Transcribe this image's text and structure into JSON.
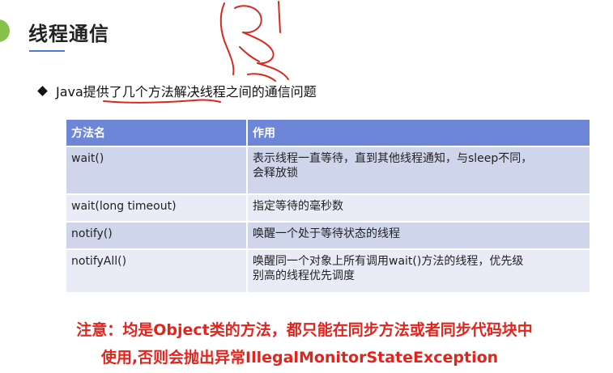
{
  "slide": {
    "title": "线程通信",
    "intro": "Java提供了几个方法解决线程之间的通信问题",
    "table": {
      "headers": [
        "方法名",
        "作用"
      ],
      "rows": [
        {
          "method": "wait()",
          "desc_line1": "表示线程一直等待，直到其他线程通知，与sleep不同，",
          "desc_line2": "会释放锁"
        },
        {
          "method": "wait(long timeout)",
          "desc_line1": "指定等待的毫秒数",
          "desc_line2": ""
        },
        {
          "method": "notify()",
          "desc_line1": "唤醒一个处于等待状态的线程",
          "desc_line2": ""
        },
        {
          "method": "notifyAll()",
          "desc_line1": "唤醒同一个对象上所有调用wait()方法的线程，优先级",
          "desc_line2": "别高的线程优先调度"
        }
      ]
    },
    "note_line1": "注意：均是Object类的方法，都只能在同步方法或者同步代码块中",
    "note_line2": "使用,否则会抛出异常IllegalMonitorStateException"
  },
  "colors": {
    "accent_green": "#86c24a",
    "header_blue": "#6d86d8",
    "row_odd": "#cfd6ec",
    "row_even": "#e9ecf6",
    "note_red": "#e2241c",
    "ink_red": "#d9281e"
  }
}
